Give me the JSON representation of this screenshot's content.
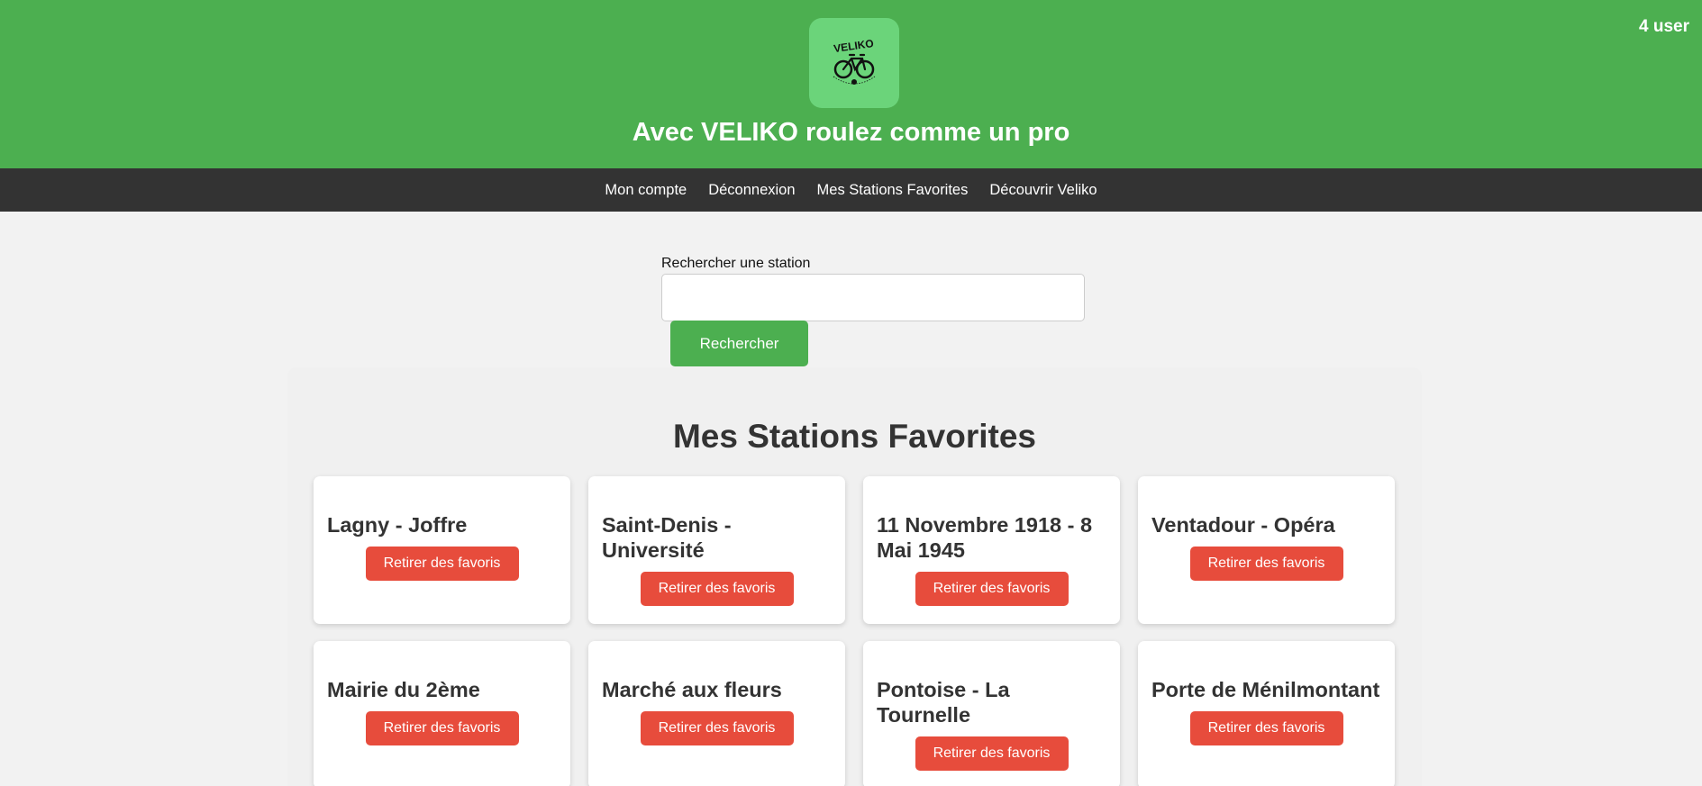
{
  "header": {
    "logo_text": "VELIKO",
    "logo_subtext": "ROULEZ COMME UN PRO",
    "tagline": "Avec VELIKO roulez comme un pro",
    "user_count": "4 user",
    "bg_color": "#4caf50"
  },
  "nav": {
    "items": [
      {
        "label": "Mon compte"
      },
      {
        "label": "Déconnexion"
      },
      {
        "label": "Mes Stations Favorites"
      },
      {
        "label": "Découvrir Veliko"
      }
    ]
  },
  "search": {
    "label": "Rechercher une station",
    "value": "",
    "button_label": "Rechercher"
  },
  "favorites": {
    "title": "Mes Stations Favorites",
    "remove_label": "Retirer des favoris",
    "stations": [
      {
        "name": "Lagny - Joffre"
      },
      {
        "name": "Saint-Denis - Université"
      },
      {
        "name": "11 Novembre 1918 - 8 Mai 1945"
      },
      {
        "name": "Ventadour - Opéra"
      },
      {
        "name": "Mairie du 2ème"
      },
      {
        "name": "Marché aux fleurs"
      },
      {
        "name": "Pontoise - La Tournelle"
      },
      {
        "name": "Porte de Ménilmontant"
      }
    ]
  }
}
